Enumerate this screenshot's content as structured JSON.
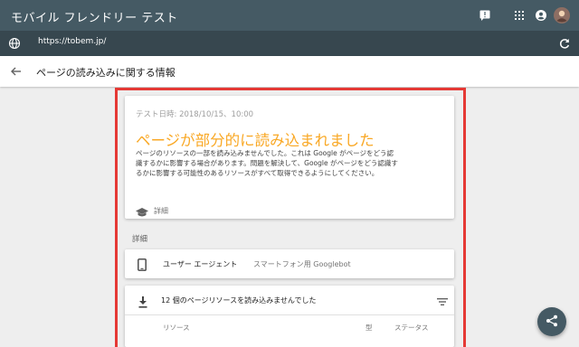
{
  "app": {
    "title": "モバイル フレンドリー テスト"
  },
  "url": {
    "value": "https://tobem.jp/"
  },
  "detail": {
    "title": "ページの読み込みに関する情報"
  },
  "summary": {
    "test_date": "テスト日時: 2018/10/15、10:00",
    "headline": "ページが部分的に読み込まれました",
    "description": "ページのリソースの一部を読み込みませんでした。これは Google がページをどう認識するかに影響する場合があります。問題を解決して、Google がページをどう認識するかに影響する可能性のあるリソースがすべて取得できるようにしてください。",
    "details_link": "詳細"
  },
  "section": {
    "label": "詳細"
  },
  "user_agent": {
    "label": "ユーザー エージェント",
    "value": "スマートフォン用 Googlebot"
  },
  "resources": {
    "label": "12 個のページリソースを読み込みませんでした",
    "columns": [
      "リソース",
      "型",
      "ステータス"
    ]
  },
  "colors": {
    "appbar": "#455a64",
    "urlbar": "#37474f",
    "headline": "#f9a825",
    "highlight": "#e53935"
  },
  "icons": [
    "feedback-icon",
    "apps-icon",
    "account-icon",
    "avatar",
    "globe-icon",
    "refresh-icon",
    "back-arrow-icon",
    "school-icon",
    "smartphone-icon",
    "download-icon",
    "filter-icon",
    "share-icon"
  ]
}
